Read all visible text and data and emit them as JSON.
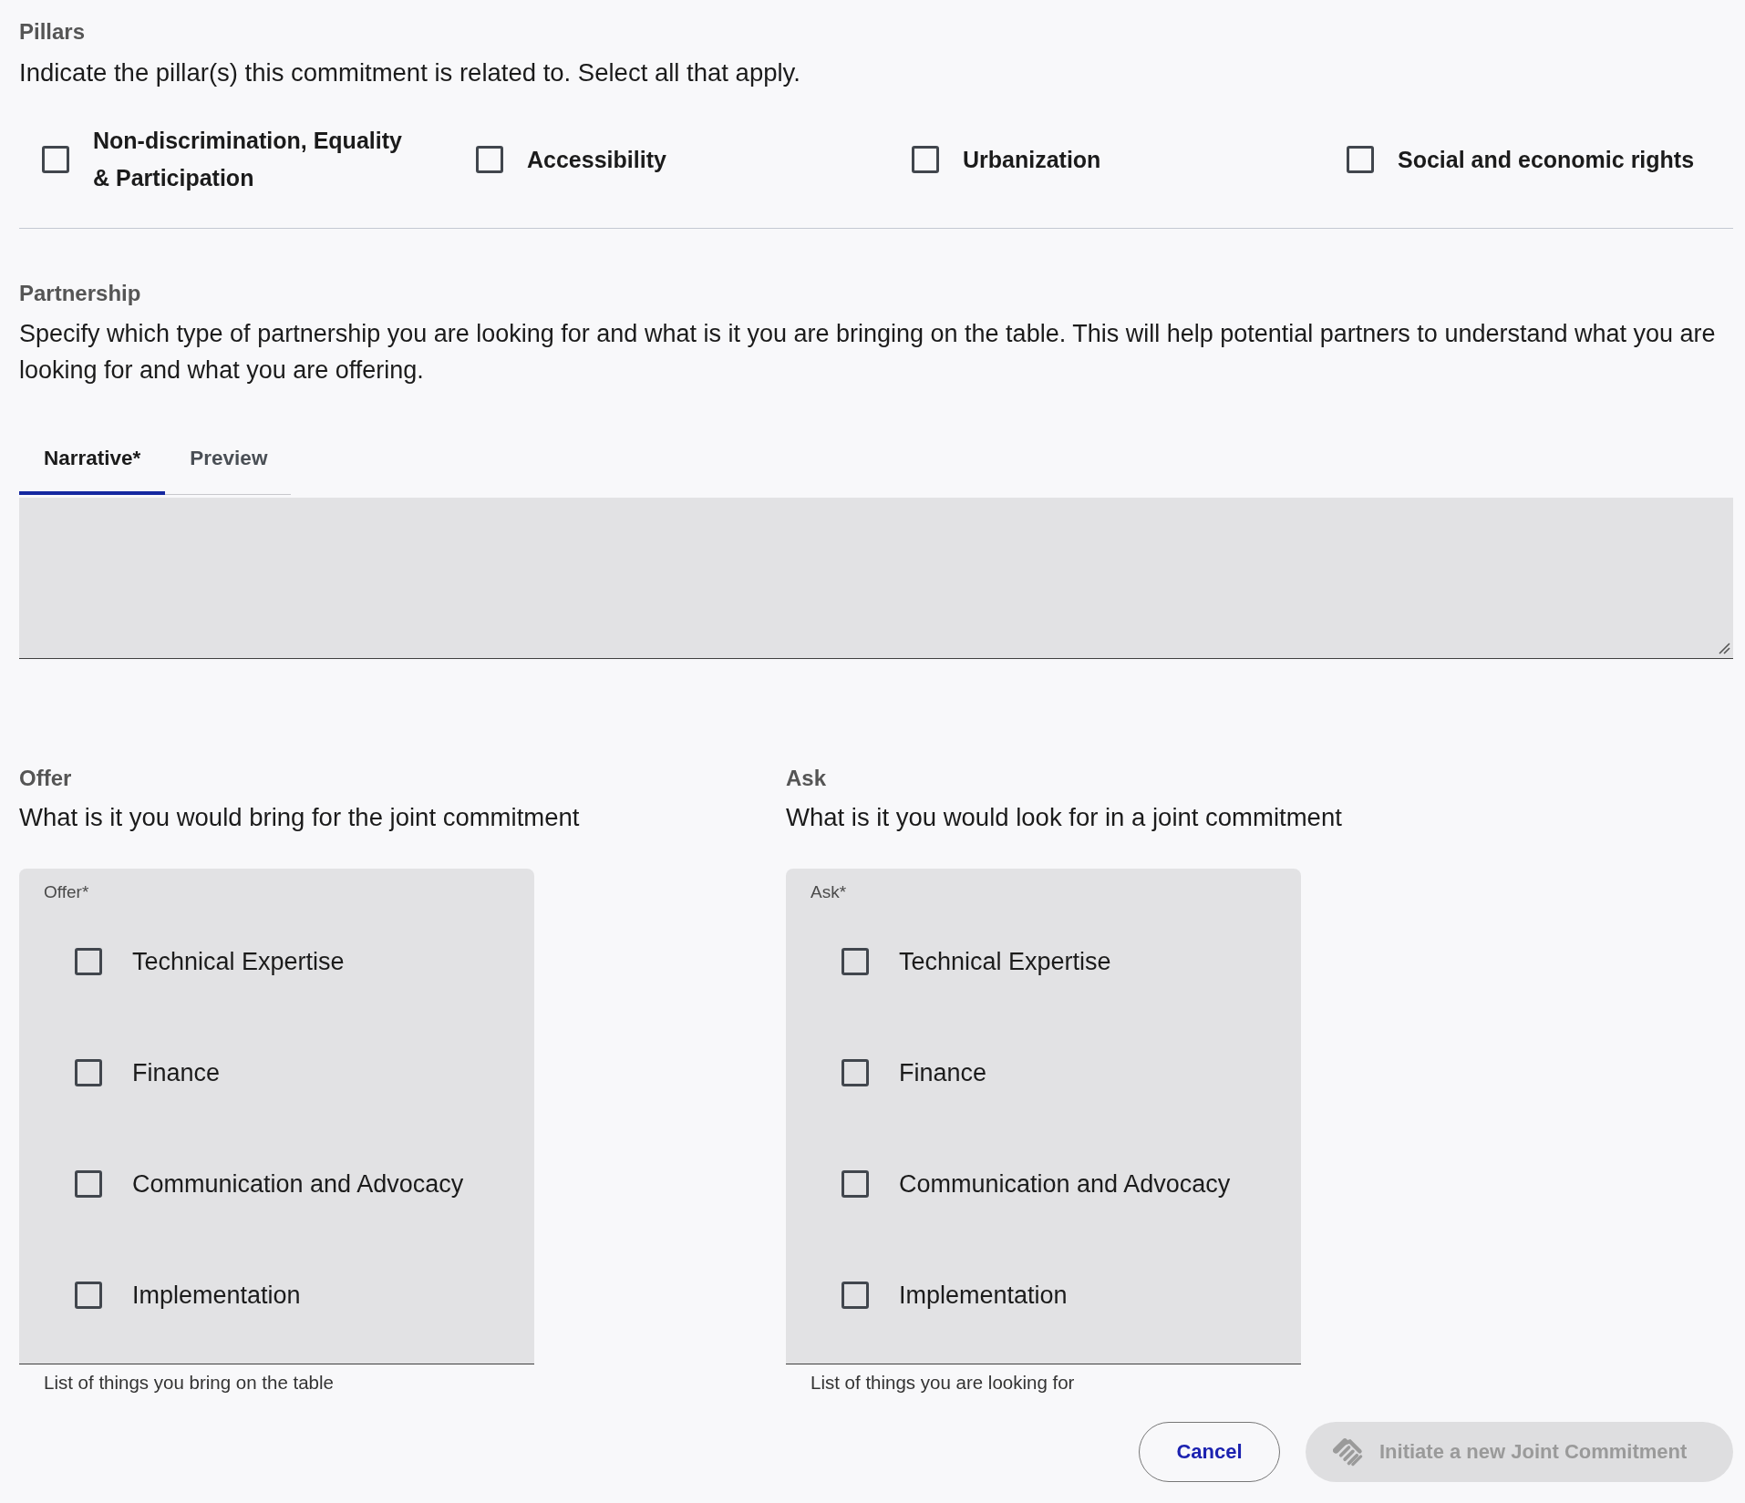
{
  "pillars": {
    "title": "Pillars",
    "description": "Indicate the pillar(s) this commitment is related to. Select all that apply.",
    "options": [
      {
        "label": "Non-discrimination, Equality & Participation",
        "checked": false
      },
      {
        "label": "Accessibility",
        "checked": false
      },
      {
        "label": "Urbanization",
        "checked": false
      },
      {
        "label": "Social and economic rights",
        "checked": false
      }
    ]
  },
  "partnership": {
    "title": "Partnership",
    "description": "Specify which type of partnership you are looking for and what is it you are bringing on the table. This will help potential partners to understand what you are looking for and what you are offering.",
    "tabs": [
      {
        "label": "Narrative*",
        "selected": true
      },
      {
        "label": "Preview",
        "selected": false
      }
    ]
  },
  "offer": {
    "title": "Offer",
    "description": "What is it you would bring for the joint commitment",
    "field_label": "Offer*",
    "options": [
      {
        "label": "Technical Expertise",
        "checked": false
      },
      {
        "label": "Finance",
        "checked": false
      },
      {
        "label": "Communication and Advocacy",
        "checked": false
      },
      {
        "label": "Implementation",
        "checked": false
      }
    ],
    "helper": "List of things you bring on the table"
  },
  "ask": {
    "title": "Ask",
    "description": "What is it you would look for in a joint commitment",
    "field_label": "Ask*",
    "options": [
      {
        "label": "Technical Expertise",
        "checked": false
      },
      {
        "label": "Finance",
        "checked": false
      },
      {
        "label": "Communication and Advocacy",
        "checked": false
      },
      {
        "label": "Implementation",
        "checked": false
      }
    ],
    "helper": "List of things you are looking for"
  },
  "buttons": [
    {
      "label": "Cancel",
      "kind": "outlined",
      "disabled": false
    },
    {
      "label": "Initiate a new Joint Commitment",
      "kind": "filled",
      "disabled": true
    }
  ]
}
